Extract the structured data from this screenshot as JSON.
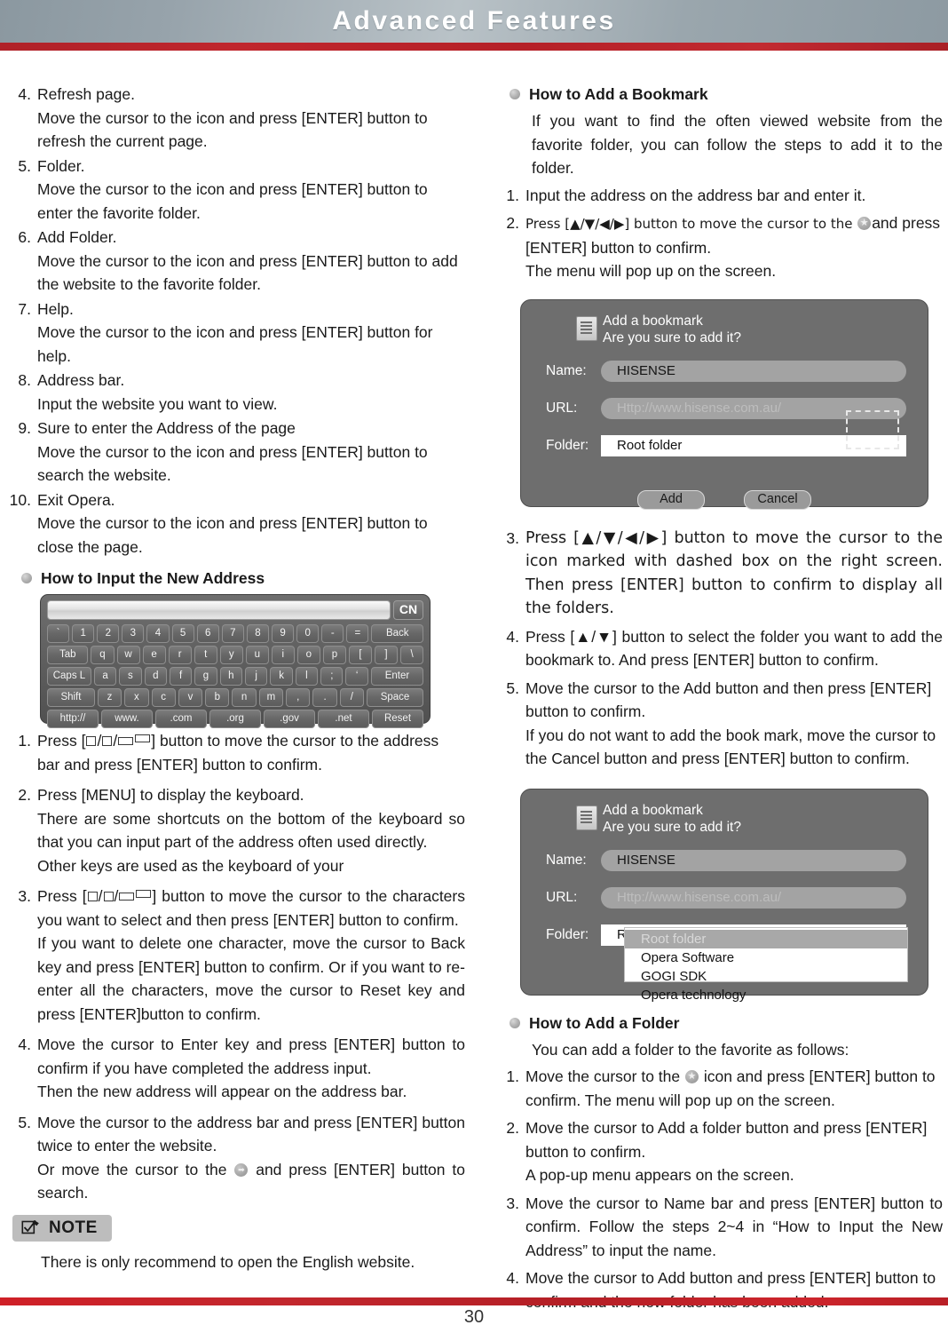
{
  "header": {
    "title": "Advanced Features"
  },
  "footer": {
    "page_number": "30"
  },
  "left_column": {
    "numbered_items": [
      {
        "num": "4.",
        "title": "Refresh page.",
        "lines": [
          "Move the cursor to the icon and press [ENTER] button to refresh the current page."
        ]
      },
      {
        "num": "5.",
        "title": "Folder.",
        "lines": [
          "Move the cursor to the icon and press [ENTER] button to enter the favorite folder."
        ]
      },
      {
        "num": "6.",
        "title": "Add Folder.",
        "lines": [
          "Move the cursor to the icon and press [ENTER] button to add the website to the favorite folder."
        ]
      },
      {
        "num": "7.",
        "title": "Help.",
        "lines": [
          "Move the cursor to the icon and press [ENTER] button for help."
        ]
      },
      {
        "num": "8.",
        "title": "Address bar.",
        "lines": [
          "Input the website you want to view."
        ]
      },
      {
        "num": "9.",
        "title": "Sure to enter the Address of the page",
        "lines": [
          "Move the cursor to the icon and press [ENTER] button to search the website."
        ]
      },
      {
        "num": "10.",
        "title": "Exit Opera.",
        "lines": [
          "Move the cursor to the icon and press [ENTER] button to close the page."
        ]
      }
    ],
    "section": {
      "bullet_icon": "bullet-dot-icon",
      "title": "How to Input the New Address"
    },
    "keyboard": {
      "address_value": "",
      "lang_key": "CN",
      "rows": [
        [
          "`",
          "1",
          "2",
          "3",
          "4",
          "5",
          "6",
          "7",
          "8",
          "9",
          "0",
          "-",
          "=",
          "Back"
        ],
        [
          "Tab",
          "q",
          "w",
          "e",
          "r",
          "t",
          "y",
          "u",
          "i",
          "o",
          "p",
          "[",
          "]",
          "\\"
        ],
        [
          "Caps L",
          "a",
          "s",
          "d",
          "f",
          "g",
          "h",
          "j",
          "k",
          "l",
          ";",
          "‘",
          "Enter"
        ],
        [
          "Shift",
          "z",
          "x",
          "c",
          "v",
          "b",
          "n",
          "m",
          ",",
          ".",
          "/",
          "Space"
        ],
        [
          "http://",
          "www.",
          ".com",
          ".org",
          ".gov",
          ".net",
          "Reset"
        ]
      ]
    },
    "steps": [
      {
        "num": "1.",
        "pre": "Press [",
        "post": "] button to move the cursor to the address bar and press [ENTER] button to confirm.",
        "lines": []
      },
      {
        "num": "2.",
        "pre": "",
        "post": "",
        "lines": [
          "Press [MENU] to display the keyboard.",
          "There are some shortcuts on the bottom of the  keyboard so that you can input part of the address often used directly.",
          "Other keys are used as the keyboard of your"
        ]
      },
      {
        "num": "3.",
        "pre": "Press [",
        "post": "] button to move the cursor to the characters you want to select and then press [ENTER] button  to confirm.",
        "lines": [
          "If you want to delete one character, move the cursor to Back key and press [ENTER] button to confirm. Or if you want to re-enter all the characters, move the cursor to Reset key and press [ENTER]button to confirm."
        ]
      },
      {
        "num": "4.",
        "pre": "",
        "post": "",
        "lines": [
          "Move the cursor to Enter key and press [ENTER] button to confirm if you have completed the address input.",
          "Then the new address will appear on the address bar."
        ]
      },
      {
        "num": "5.",
        "pre": "",
        "post": "",
        "lines": [
          "Move the cursor to the address bar and press [ENTER] button twice to enter the website."
        ],
        "icon_line": {
          "pre": "Or move the cursor to the ",
          "icon": "arrow-circle-icon",
          "post": " and press [ENTER] button to search."
        }
      }
    ],
    "note": {
      "icon": "checkbox-pen-icon",
      "label": "NOTE",
      "text": "There is only recommend to open the English website."
    }
  },
  "right_column": {
    "bookmark_section": {
      "bullet_icon": "bullet-dot-icon",
      "title": "How to Add a Bookmark",
      "intro": "If you want to find the often viewed website from the favorite folder, you can follow the steps to add it to the folder.",
      "steps_before": [
        {
          "num": "1.",
          "text": "Input the address on the address bar and enter it."
        },
        {
          "num": "2.",
          "pre": "Press [▲/▼/◀/▶] button to move the cursor to the ",
          "icon": "star-circle-icon",
          "post": "and press [ENTER] button to confirm.",
          "extra": "The menu will pop up on the screen."
        }
      ],
      "steps_after": [
        {
          "num": "3.",
          "text": "Press [▲/▼/◀/▶] button to move the cursor to the icon marked with dashed box on the right screen. Then press [ENTER] button to confirm to display all the folders."
        },
        {
          "num": "4.",
          "text": "Press [▲/▼] button  to select the folder you want to add the bookmark to. And press [ENTER] button to confirm."
        },
        {
          "num": "5.",
          "text": "Move the cursor to the Add button and then press [ENTER] button to confirm.",
          "extra": "If you do not want to add the book mark, move the cursor to the Cancel button and press [ENTER] button to confirm."
        }
      ]
    },
    "dialog1": {
      "icon": "document-icon",
      "title": "Add a bookmark",
      "subtitle": "Are you sure to add it?",
      "name_label": "Name:",
      "name_value": "HISENSE",
      "url_label": "URL:",
      "url_value": "Http://www.hisense.com.au/",
      "folder_label": "Folder:",
      "folder_value": "Root folder",
      "add_button": "Add",
      "cancel_button": "Cancel"
    },
    "dialog2": {
      "icon": "document-icon",
      "title": "Add a bookmark",
      "subtitle": "Are you sure to add it?",
      "name_label": "Name:",
      "name_value": "HISENSE",
      "url_label": "URL:",
      "url_value": "Http://www.hisense.com.au/",
      "folder_label": "Folder:",
      "folder_value": "Root folder",
      "folder_options": [
        "Root folder",
        "Opera Software",
        "GOGI SDK",
        "Opera technology"
      ],
      "selected_option_index": 0
    },
    "folder_section": {
      "bullet_icon": "bullet-dot-icon",
      "title": "How to Add a Folder",
      "intro": "You can add a folder to the favorite as follows:",
      "steps": [
        {
          "num": "1.",
          "pre": "Move the cursor to the ",
          "icon": "star-circle-icon",
          "post": " icon and press [ENTER] button to confirm. The menu will pop up on the screen."
        },
        {
          "num": "2.",
          "text": "Move the cursor to Add a folder button and press [ENTER] button to confirm.",
          "extra": "A pop-up menu appears on the screen."
        },
        {
          "num": "3.",
          "text": "Move the cursor to Name bar and press [ENTER] button to confirm. Follow the steps 2~4 in “How to Input the New Address” to input the name."
        },
        {
          "num": "4.",
          "text": "Move the cursor to Add button and press [ENTER] button to confirm and the new folder has been added."
        }
      ]
    }
  }
}
